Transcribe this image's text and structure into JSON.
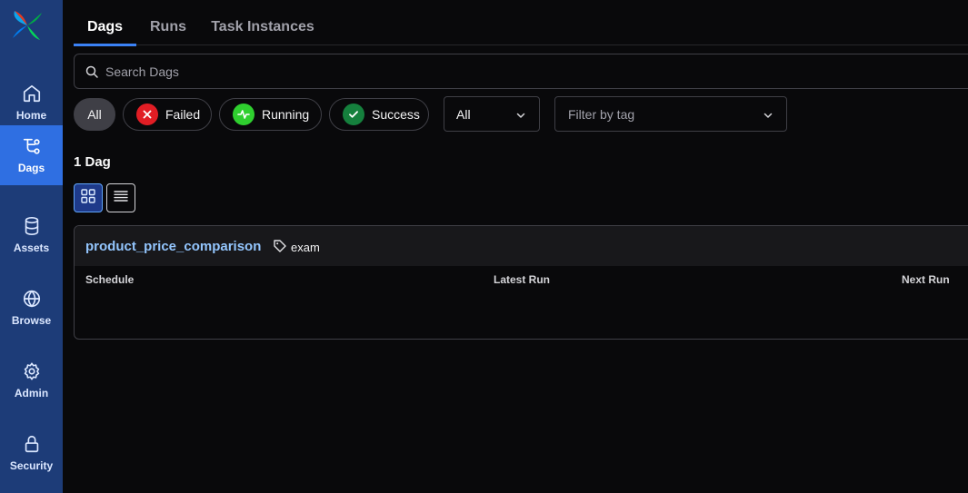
{
  "sidebar": {
    "items": [
      {
        "label": "Home",
        "icon": "home-icon",
        "active": false
      },
      {
        "label": "Dags",
        "icon": "dags-icon",
        "active": true
      },
      {
        "label": "Assets",
        "icon": "database-icon",
        "active": false
      },
      {
        "label": "Browse",
        "icon": "globe-icon",
        "active": false
      },
      {
        "label": "Admin",
        "icon": "gear-icon",
        "active": false
      },
      {
        "label": "Security",
        "icon": "lock-icon",
        "active": false
      }
    ]
  },
  "tabs": [
    {
      "label": "Dags",
      "active": true
    },
    {
      "label": "Runs",
      "active": false
    },
    {
      "label": "Task Instances",
      "active": false
    }
  ],
  "search": {
    "placeholder": "Search Dags"
  },
  "filters": {
    "state_pills": [
      {
        "label": "All",
        "selected": true
      },
      {
        "label": "Failed",
        "color": "#e11d24"
      },
      {
        "label": "Running",
        "color": "#2fcf2f"
      },
      {
        "label": "Success",
        "color": "#15803d"
      }
    ],
    "paused_select": {
      "value": "All"
    },
    "tag_select": {
      "placeholder": "Filter by tag"
    }
  },
  "results": {
    "count_label": "1 Dag"
  },
  "dag_card": {
    "dag_id": "product_price_comparison",
    "tag": "exam",
    "columns": [
      "Schedule",
      "Latest Run",
      "Next Run"
    ]
  },
  "colors": {
    "sidebar_bg": "#1d3c78",
    "sidebar_active": "#2f6fe2",
    "accent": "#3b82f6",
    "dag_link": "#93c5fd",
    "background": "#09090b"
  }
}
